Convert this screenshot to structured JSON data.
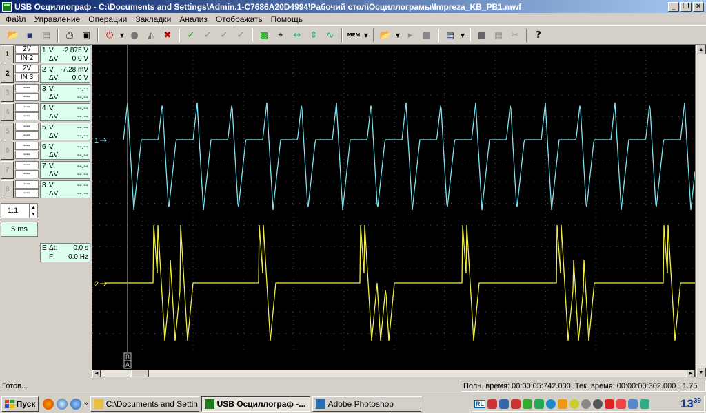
{
  "window": {
    "title": "USB Осциллограф - C:\\Documents and Settings\\Admin.1-C7686A20D4994\\Рабочий стол\\Осциллограмы\\Impreza_KB_PB1.mwf"
  },
  "menu": [
    "Файл",
    "Управление",
    "Операции",
    "Закладки",
    "Анализ",
    "Отображать",
    "Помощь"
  ],
  "toolbar": {
    "mem_label": "MEM"
  },
  "channels": [
    {
      "num": "1",
      "btn": "1",
      "range": "2V",
      "input": "IN 2",
      "v1": "-2.875 V",
      "v2": "0.0 V",
      "active": true
    },
    {
      "num": "2",
      "btn": "2",
      "range": "2V",
      "input": "IN 3",
      "v1": "-7.28 mV",
      "v2": "0.0 V",
      "active": true
    },
    {
      "num": "3",
      "btn": "3",
      "range": "---",
      "input": "---",
      "v1": "--.--",
      "v2": "--.--",
      "active": false
    },
    {
      "num": "4",
      "btn": "4",
      "range": "---",
      "input": "---",
      "v1": "--.--",
      "v2": "--.--",
      "active": false
    },
    {
      "num": "5",
      "btn": "5",
      "range": "---",
      "input": "---",
      "v1": "--.--",
      "v2": "--.--",
      "active": false
    },
    {
      "num": "6",
      "btn": "6",
      "range": "---",
      "input": "---",
      "v1": "--.--",
      "v2": "--.--",
      "active": false
    },
    {
      "num": "7",
      "btn": "7",
      "range": "---",
      "input": "---",
      "v1": "--.--",
      "v2": "--.--",
      "active": false
    },
    {
      "num": "8",
      "btn": "8",
      "range": "---",
      "input": "---",
      "v1": "--.--",
      "v2": "--.--",
      "active": false
    }
  ],
  "labels": {
    "v": "V:",
    "dv": "ΔV:",
    "dt": "Δt:",
    "f": "F:",
    "e": "E"
  },
  "time": {
    "dt": "0.0 s",
    "f": "0.0 Hz"
  },
  "zoom": "1:1",
  "timebase": "5 ms",
  "scope": {
    "ch1_marker": "1",
    "ch2_marker": "2",
    "cursor_b": "B",
    "cursor_a": "A",
    "ch1_color": "#7fe3ef",
    "ch2_color": "#f2ee44",
    "grid_color": "#5a5a5a"
  },
  "status": {
    "left": "Готов...",
    "times": "Полн. время: 00:00:05:742.000, Тек. время: 00:00:00:302.000",
    "value": "1.75"
  },
  "taskbar": {
    "start": "Пуск",
    "tasks": [
      "C:\\Documents and Settin...",
      "USB Осциллограф -...",
      "Adobe Photoshop"
    ],
    "lang": "RL",
    "clock_h": "13",
    "clock_m": "39"
  }
}
